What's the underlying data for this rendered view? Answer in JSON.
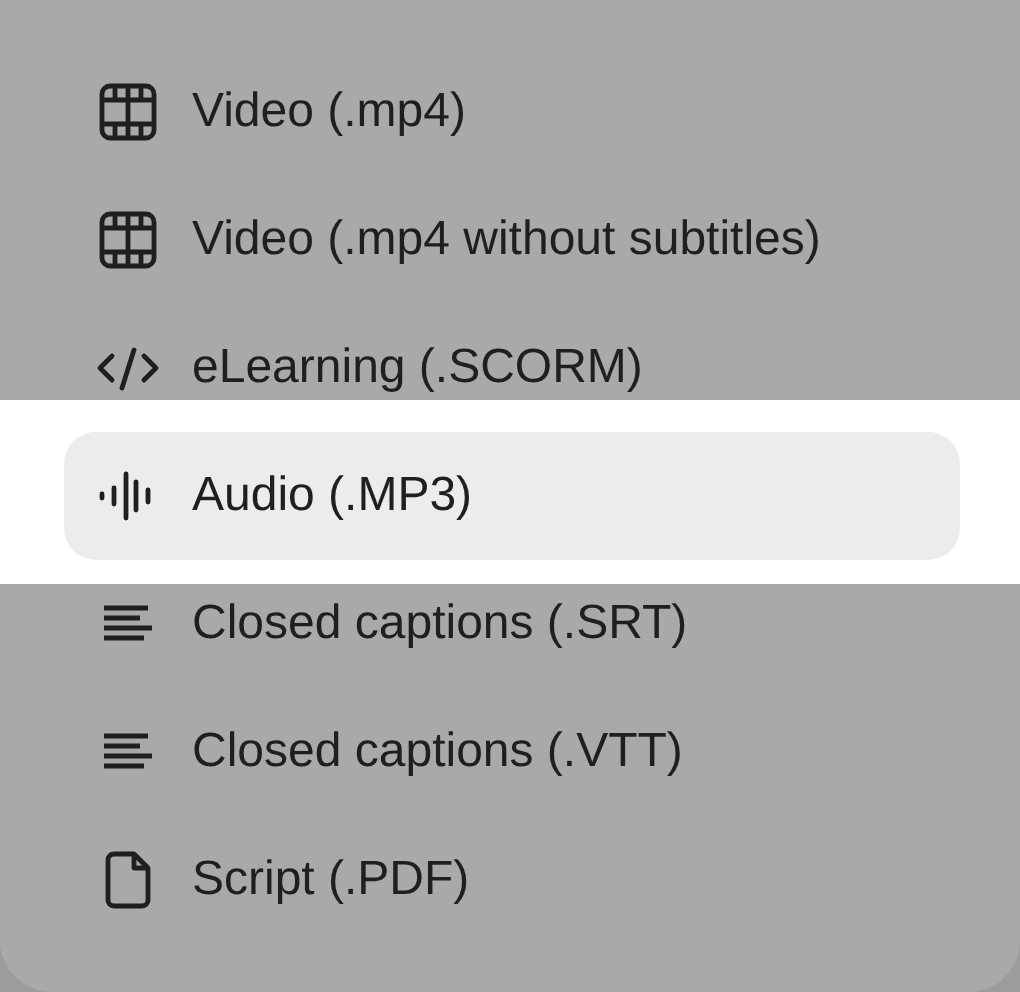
{
  "menu": {
    "items": [
      {
        "label": "Video (.mp4)",
        "kind": "video",
        "selected": false
      },
      {
        "label": "Video (.mp4 without subtitles)",
        "kind": "video",
        "selected": false
      },
      {
        "label": "eLearning (.SCORM)",
        "kind": "elearning",
        "selected": false
      },
      {
        "label": "Audio (.MP3)",
        "kind": "audio",
        "selected": true
      },
      {
        "label": "Closed captions (.SRT)",
        "kind": "captions",
        "selected": false
      },
      {
        "label": "Closed captions (.VTT)",
        "kind": "captions",
        "selected": false
      },
      {
        "label": "Script (.PDF)",
        "kind": "document",
        "selected": false
      }
    ]
  }
}
